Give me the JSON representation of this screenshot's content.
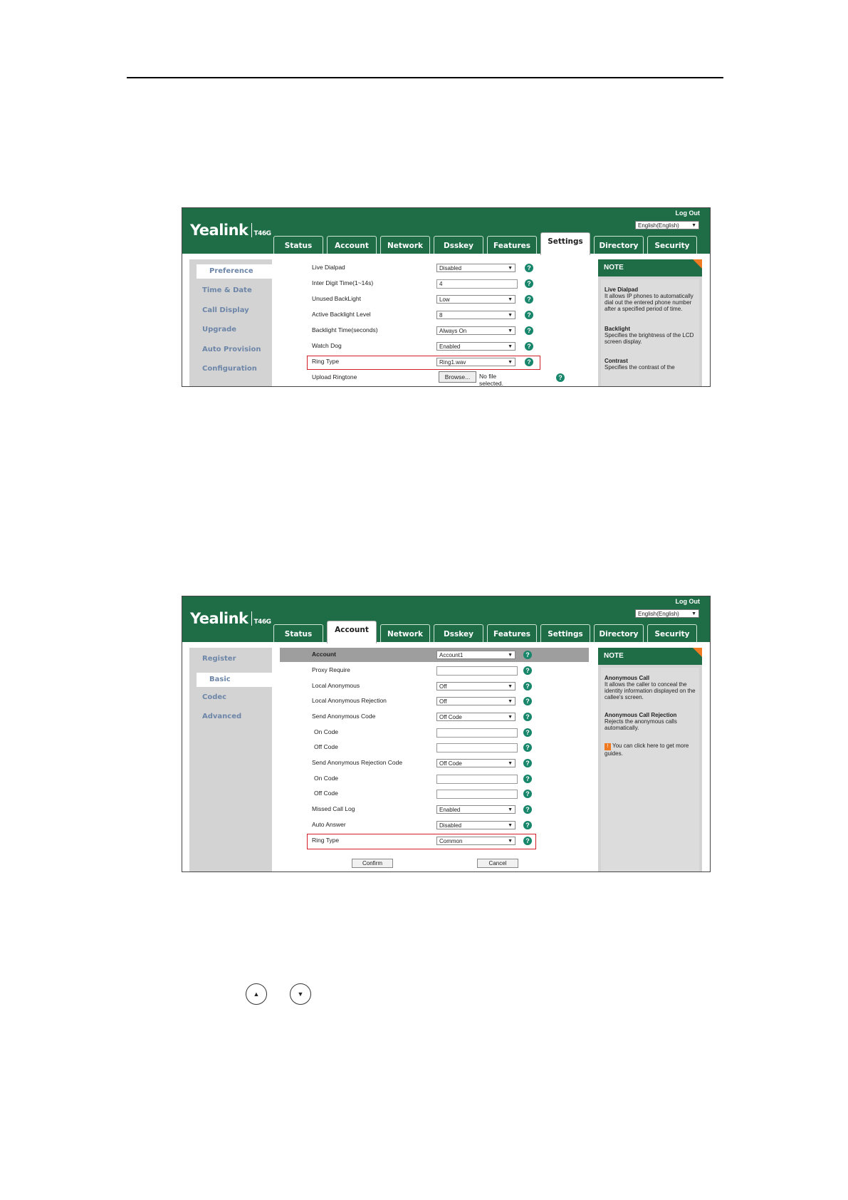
{
  "screenshot1": {
    "logo": "Yealink",
    "model": "T46G",
    "logout": "Log Out",
    "language": "English(English)",
    "tabs": [
      "Status",
      "Account",
      "Network",
      "Dsskey",
      "Features",
      "Settings",
      "Directory",
      "Security"
    ],
    "active_tab": "Settings",
    "sidebar": [
      "Preference",
      "Time & Date",
      "Call Display",
      "Upgrade",
      "Auto Provision",
      "Configuration"
    ],
    "fields": [
      {
        "label": "Live Dialpad",
        "value": "Disabled"
      },
      {
        "label": "Inter Digit Time(1~14s)",
        "value": "4"
      },
      {
        "label": "Unused BackLight",
        "value": "Low"
      },
      {
        "label": "Active Backlight Level",
        "value": "8"
      },
      {
        "label": "Backlight Time(seconds)",
        "value": "Always On"
      },
      {
        "label": "Watch Dog",
        "value": "Enabled"
      },
      {
        "label": "Ring Type",
        "value": "Ring1.wav"
      },
      {
        "label": "Upload Ringtone",
        "browse": "Browse...",
        "file_status": "No file selected."
      }
    ],
    "note": {
      "title": "NOTE",
      "items": [
        {
          "heading": "Live Dialpad",
          "text": "It allows IP phones to automatically dial out the entered phone number after a specified period of time."
        },
        {
          "heading": "Backlight",
          "text": "Specifies the brightness of the LCD screen display."
        },
        {
          "heading": "Contrast",
          "text": "Specifies the contrast of the"
        }
      ]
    }
  },
  "screenshot2": {
    "logo": "Yealink",
    "model": "T46G",
    "logout": "Log Out",
    "language": "English(English)",
    "tabs": [
      "Status",
      "Account",
      "Network",
      "Dsskey",
      "Features",
      "Settings",
      "Directory",
      "Security"
    ],
    "active_tab": "Account",
    "sidebar": [
      "Register",
      "Basic",
      "Codec",
      "Advanced"
    ],
    "account_label": "Account",
    "account_value": "Account1",
    "fields": [
      {
        "label": "Proxy Require",
        "value": ""
      },
      {
        "label": "Local Anonymous",
        "value": "Off"
      },
      {
        "label": "Local Anonymous Rejection",
        "value": "Off"
      },
      {
        "label": "Send Anonymous Code",
        "value": "Off Code"
      },
      {
        "label": "On Code",
        "value": ""
      },
      {
        "label": "Off Code",
        "value": ""
      },
      {
        "label": "Send Anonymous Rejection Code",
        "value": "Off Code"
      },
      {
        "label": "On Code",
        "value": ""
      },
      {
        "label": "Off Code",
        "value": ""
      },
      {
        "label": "Missed Call Log",
        "value": "Enabled"
      },
      {
        "label": "Auto Answer",
        "value": "Disabled"
      },
      {
        "label": "Ring Type",
        "value": "Common"
      }
    ],
    "confirm": "Confirm",
    "cancel": "Cancel",
    "note": {
      "title": "NOTE",
      "items": [
        {
          "heading": "Anonymous Call",
          "text": "It allows the caller to conceal the identity information displayed on the callee's screen."
        },
        {
          "heading": "Anonymous Call Rejection",
          "text": "Rejects the anonymous calls automatically."
        },
        {
          "heading": "",
          "text": "You can click here to get more guides."
        }
      ]
    }
  },
  "keys": {
    "up": "up-arrow",
    "down": "down-arrow"
  },
  "colors": {
    "header_green": "#1f6d47",
    "highlight_red": "#d21f2a",
    "help_teal": "#17866b",
    "note_corner": "#f07a22"
  }
}
